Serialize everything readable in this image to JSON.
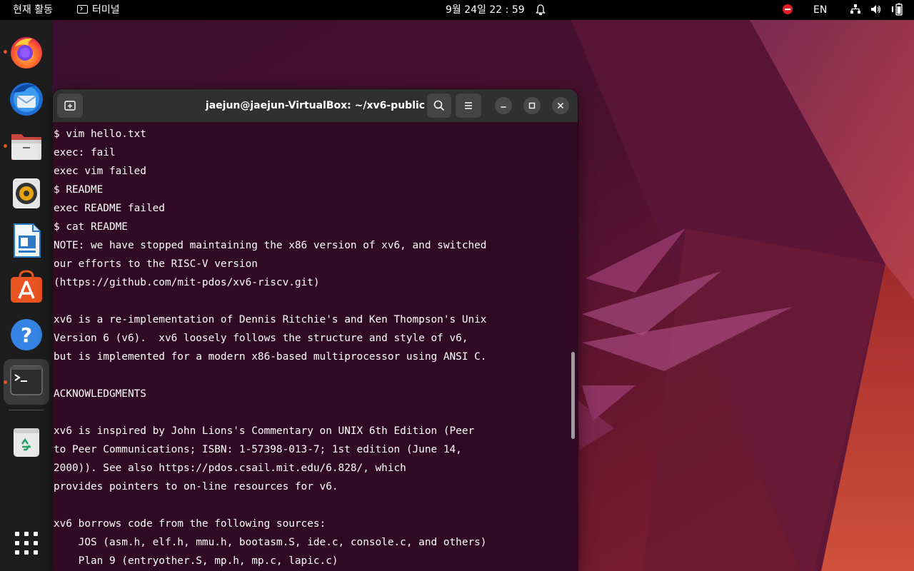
{
  "topbar": {
    "activities": "현재 활동",
    "app_menu": "터미널",
    "clock": "9월 24일  22 : 59",
    "language": "EN",
    "icons": [
      "bell-icon",
      "do-not-disturb-icon",
      "network-icon",
      "volume-icon",
      "battery-icon"
    ]
  },
  "dock": {
    "items": [
      {
        "name": "firefox",
        "icon": "firefox-icon",
        "running": true
      },
      {
        "name": "thunderbird",
        "icon": "thunderbird-icon",
        "running": false
      },
      {
        "name": "files",
        "icon": "files-icon",
        "running": true
      },
      {
        "name": "rhythmbox",
        "icon": "rhythmbox-icon",
        "running": false
      },
      {
        "name": "libreoffice-writer",
        "icon": "writer-icon",
        "running": false
      },
      {
        "name": "app-center",
        "icon": "app-center-icon",
        "running": false
      },
      {
        "name": "help",
        "icon": "help-icon",
        "running": false
      },
      {
        "name": "terminal",
        "icon": "terminal-icon",
        "running": true
      },
      {
        "name": "trash",
        "icon": "trash-icon",
        "running": false
      },
      {
        "name": "show-apps",
        "icon": "app-grid-icon",
        "running": false
      }
    ]
  },
  "terminal": {
    "title": "jaejun@jaejun-VirtualBox: ~/xv6-public",
    "lines": [
      "$ vim hello.txt",
      "exec: fail",
      "exec vim failed",
      "$ README",
      "exec README failed",
      "$ cat README",
      "NOTE: we have stopped maintaining the x86 version of xv6, and switched",
      "our efforts to the RISC-V version",
      "(https://github.com/mit-pdos/xv6-riscv.git)",
      "",
      "xv6 is a re-implementation of Dennis Ritchie's and Ken Thompson's Unix",
      "Version 6 (v6).  xv6 loosely follows the structure and style of v6,",
      "but is implemented for a modern x86-based multiprocessor using ANSI C.",
      "",
      "ACKNOWLEDGMENTS",
      "",
      "xv6 is inspired by John Lions's Commentary on UNIX 6th Edition (Peer",
      "to Peer Communications; ISBN: 1-57398-013-7; 1st edition (June 14,",
      "2000)). See also https://pdos.csail.mit.edu/6.828/, which",
      "provides pointers to on-line resources for v6.",
      "",
      "xv6 borrows code from the following sources:",
      "    JOS (asm.h, elf.h, mmu.h, bootasm.S, ide.c, console.c, and others)",
      "    Plan 9 (entryother.S, mp.h, mp.c, lapic.c)"
    ]
  },
  "colors": {
    "terminal_bg": "#300a24",
    "accent": "#e95420",
    "headerbar": "#303030"
  }
}
